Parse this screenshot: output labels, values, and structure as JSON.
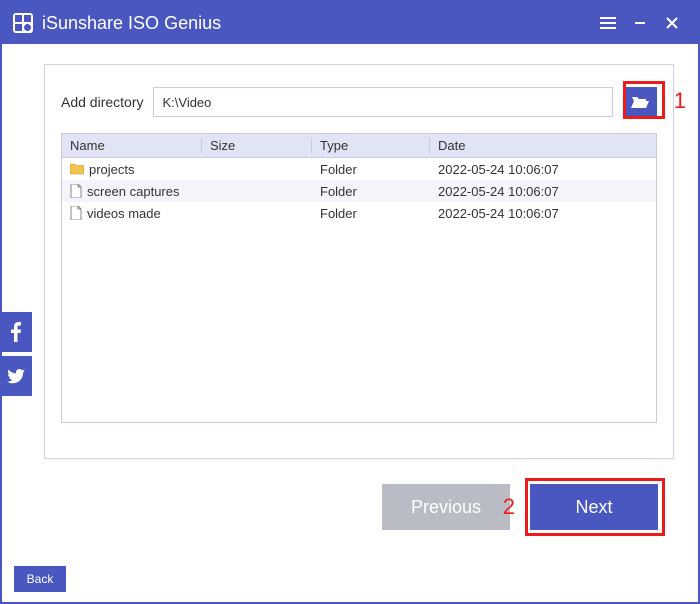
{
  "app": {
    "title": "iSunshare ISO Genius"
  },
  "addDirectory": {
    "label": "Add directory",
    "value": "K:\\Video"
  },
  "table": {
    "headers": {
      "name": "Name",
      "size": "Size",
      "type": "Type",
      "date": "Date"
    },
    "rows": [
      {
        "icon": "folder",
        "name": "projects",
        "size": "",
        "type": "Folder",
        "date": "2022-05-24 10:06:07"
      },
      {
        "icon": "file",
        "name": "screen captures",
        "size": "",
        "type": "Folder",
        "date": "2022-05-24 10:06:07"
      },
      {
        "icon": "file",
        "name": "videos made",
        "size": "",
        "type": "Folder",
        "date": "2022-05-24 10:06:07"
      }
    ]
  },
  "buttons": {
    "previous": "Previous",
    "next": "Next",
    "back": "Back"
  },
  "annotations": {
    "browse": "1",
    "next": "2"
  }
}
